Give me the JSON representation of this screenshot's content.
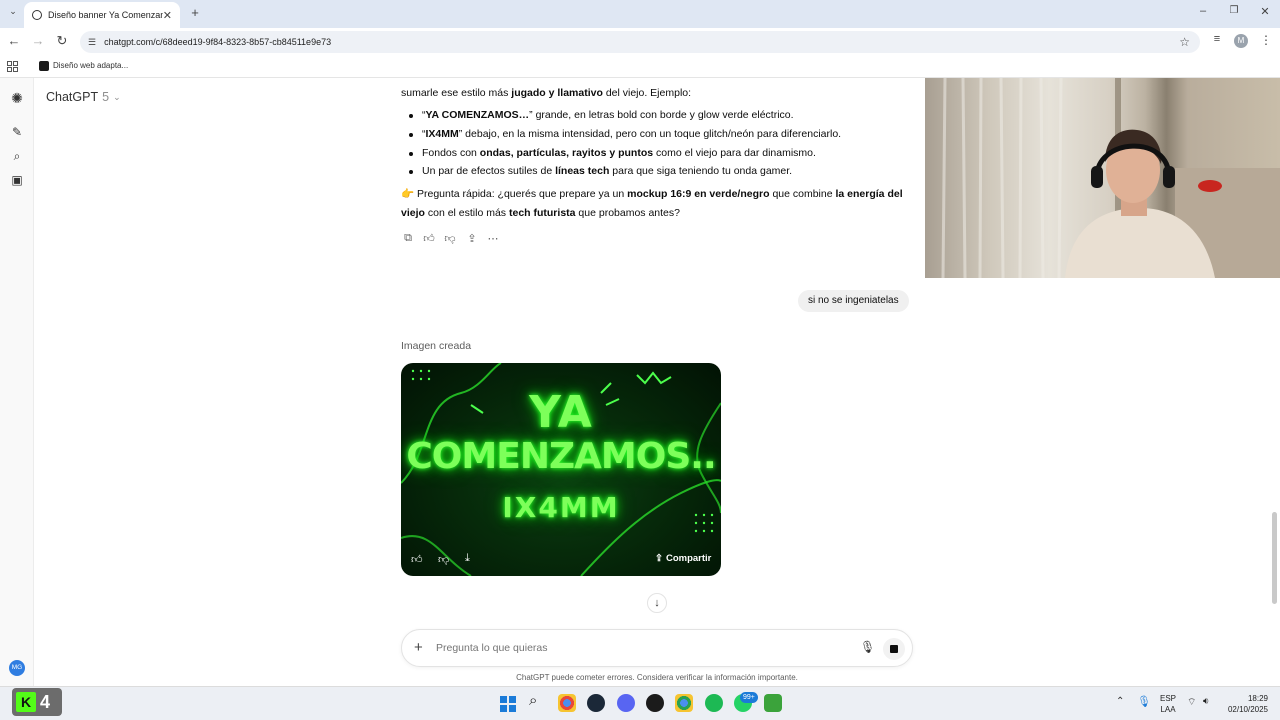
{
  "browser": {
    "tab_title": "Diseño banner Ya Comenzamos",
    "url": "chatgpt.com/c/68deed19-9f84-8323-8b57-cb84511e9e73",
    "bookmark": "Diseño web adapta...",
    "profile_initial": "M"
  },
  "sidebar": {
    "model_name": "ChatGPT",
    "model_version": "5",
    "user_initials": "MG"
  },
  "chat": {
    "intro_prefix": "sumarle ese estilo más ",
    "intro_bold": "jugado y llamativo",
    "intro_suffix": " del viejo. Ejemplo:",
    "bullets": [
      {
        "pre": "“",
        "bold": "YA COMENZAMOS…",
        "post": "” grande, en letras bold con borde y glow verde eléctrico."
      },
      {
        "pre": "“",
        "bold": "IX4MM",
        "post": "” debajo, en la misma intensidad, pero con un toque glitch/neón para diferenciarlo."
      },
      {
        "pre": "Fondos con ",
        "bold": "ondas, partículas, rayitos y puntos",
        "post": " como el viejo para dar dinamismo."
      },
      {
        "pre": "Un par de efectos sutiles de ",
        "bold": "líneas tech",
        "post": " para que siga teniendo tu onda gamer."
      }
    ],
    "question": {
      "emoji": "👉",
      "t1": " Pregunta rápida: ¿querés que prepare ya un ",
      "b1": "mockup 16:9 en verde/negro",
      "t2": " que combine ",
      "b2": "la energía del viejo",
      "t3": " con el estilo más ",
      "b3": "tech futurista",
      "t4": " que probamos antes?"
    },
    "user_message": "si no se ingeniatelas",
    "image_label": "Imagen creada",
    "image_text": {
      "line1": "YA",
      "line2": "COMENZAMOS..",
      "line3": "IX4MM"
    },
    "share_label": "Compartir"
  },
  "composer": {
    "placeholder": "Pregunta lo que quieras"
  },
  "disclaimer": "ChatGPT puede cometer errores. Considera verificar la información importante.",
  "taskbar": {
    "widget_number": "4",
    "badge_count": "99+",
    "lang_top": "ESP",
    "lang_bottom": "LAA",
    "time": "18:29",
    "date": "02/10/2025"
  },
  "colors": {
    "neon_green": "#7dff5a",
    "chrome_tab_bg": "#dfe7f3",
    "bubble_bg": "#f0f0f0"
  }
}
